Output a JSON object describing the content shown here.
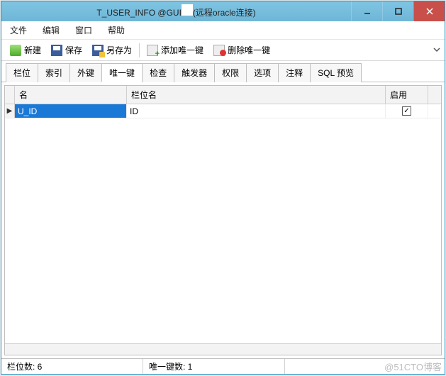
{
  "title_prefix": "T_USER_INFO @GUI",
  "title_suffix": "(远程oracle连接)",
  "menu": {
    "file": "文件",
    "edit": "编辑",
    "window": "窗口",
    "help": "帮助"
  },
  "toolbar": {
    "new": "新建",
    "save": "保存",
    "saveas": "另存为",
    "addunique": "添加唯一键",
    "delunique": "删除唯一键"
  },
  "tabs": {
    "fields": "栏位",
    "indexes": "索引",
    "fkeys": "外键",
    "uniques": "唯一键",
    "checks": "检查",
    "triggers": "触发器",
    "privs": "权限",
    "options": "选项",
    "comment": "注释",
    "sqlpreview": "SQL 预览"
  },
  "grid": {
    "col_name": "名",
    "col_fieldname": "栏位名",
    "col_enabled": "启用",
    "rows": [
      {
        "name": "U_ID",
        "field": "ID",
        "enabled": true
      }
    ]
  },
  "status": {
    "fieldcount": "栏位数: 6",
    "uniquecount": "唯一键数: 1"
  },
  "watermark": "@51CTO博客"
}
